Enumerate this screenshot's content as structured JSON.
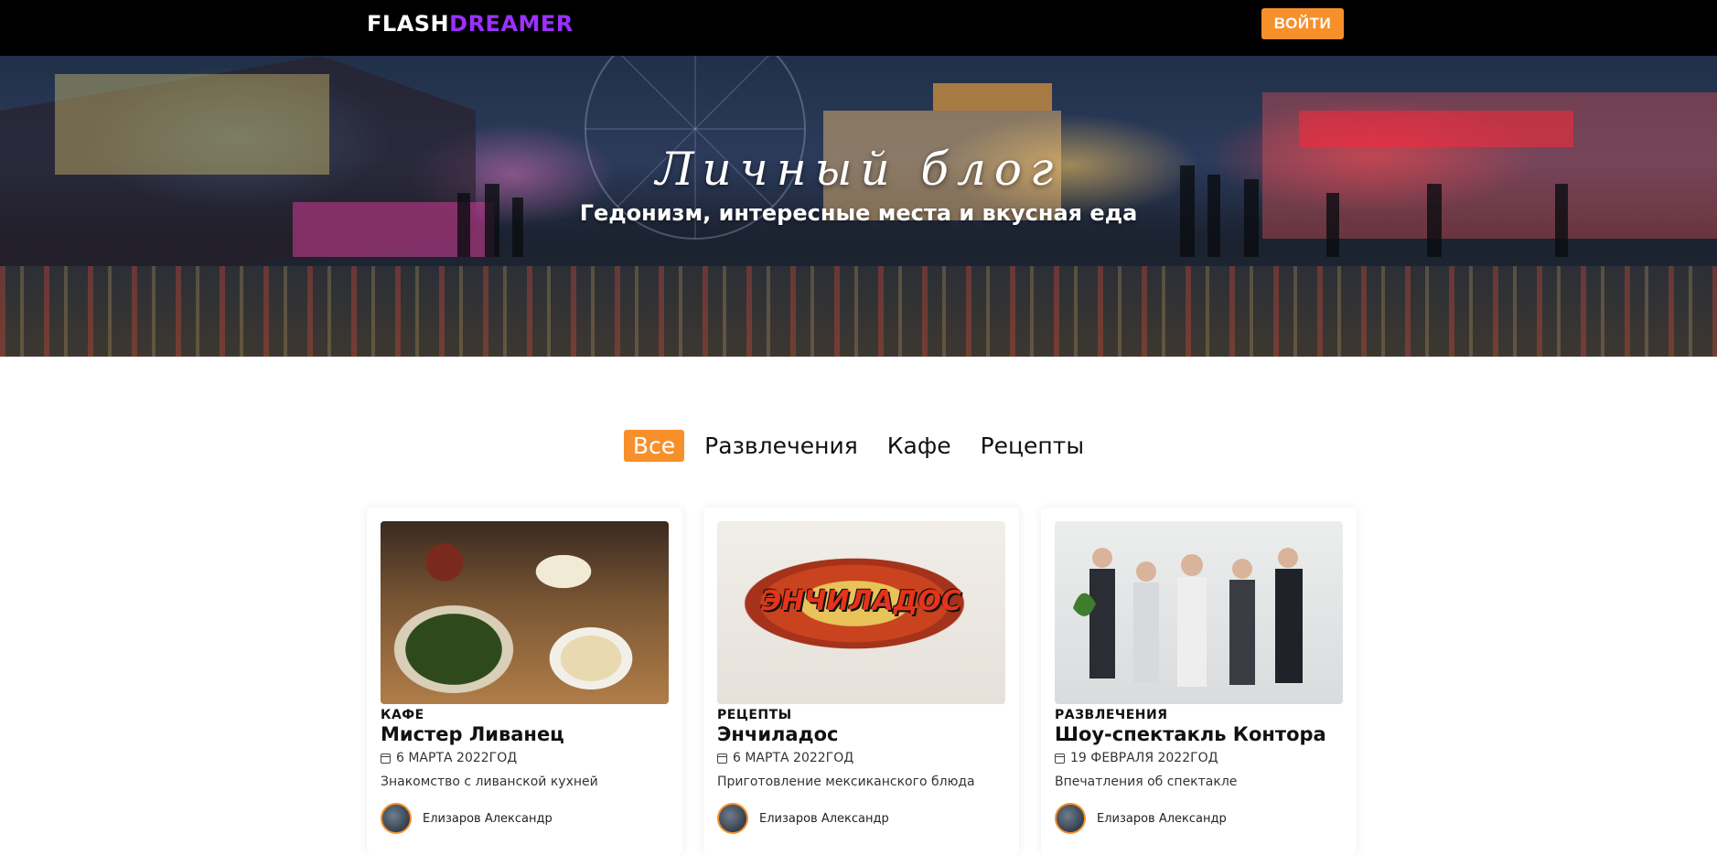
{
  "header": {
    "logo_part1": "FLASH",
    "logo_part2": "DREAMER",
    "login_label": "ВОЙТИ",
    "accent_color": "#f7902b",
    "logo_accent_color": "#9b30ff"
  },
  "hero": {
    "title": "Личный блог",
    "subtitle": "Гедонизм, интересные места и вкусная еда"
  },
  "filters": {
    "active": "Все",
    "items": [
      "Все",
      "Развлечения",
      "Кафе",
      "Рецепты"
    ]
  },
  "cards": [
    {
      "category": "КАФЕ",
      "title": "Мистер Ливанец",
      "date": "6 МАРТА 2022ГОД",
      "description": "Знакомство с ливанской кухней",
      "author": "Елизаров Александр",
      "image_icon": "food-photo"
    },
    {
      "category": "РЕЦЕПТЫ",
      "title": "Энчиладос",
      "date": "6 МАРТА 2022ГОД",
      "description": "Приготовление мексиканского блюда",
      "author": "Елизаров Александр",
      "image_icon": "enchilada-photo",
      "image_caption": "ЭНЧИЛАДОС"
    },
    {
      "category": "РАЗВЛЕЧЕНИЯ",
      "title": "Шоу-спектакль Контора",
      "date": "19 ФЕВРАЛЯ 2022ГОД",
      "description": "Впечатления об спектакле",
      "author": "Елизаров Александр",
      "image_icon": "group-photo"
    }
  ]
}
